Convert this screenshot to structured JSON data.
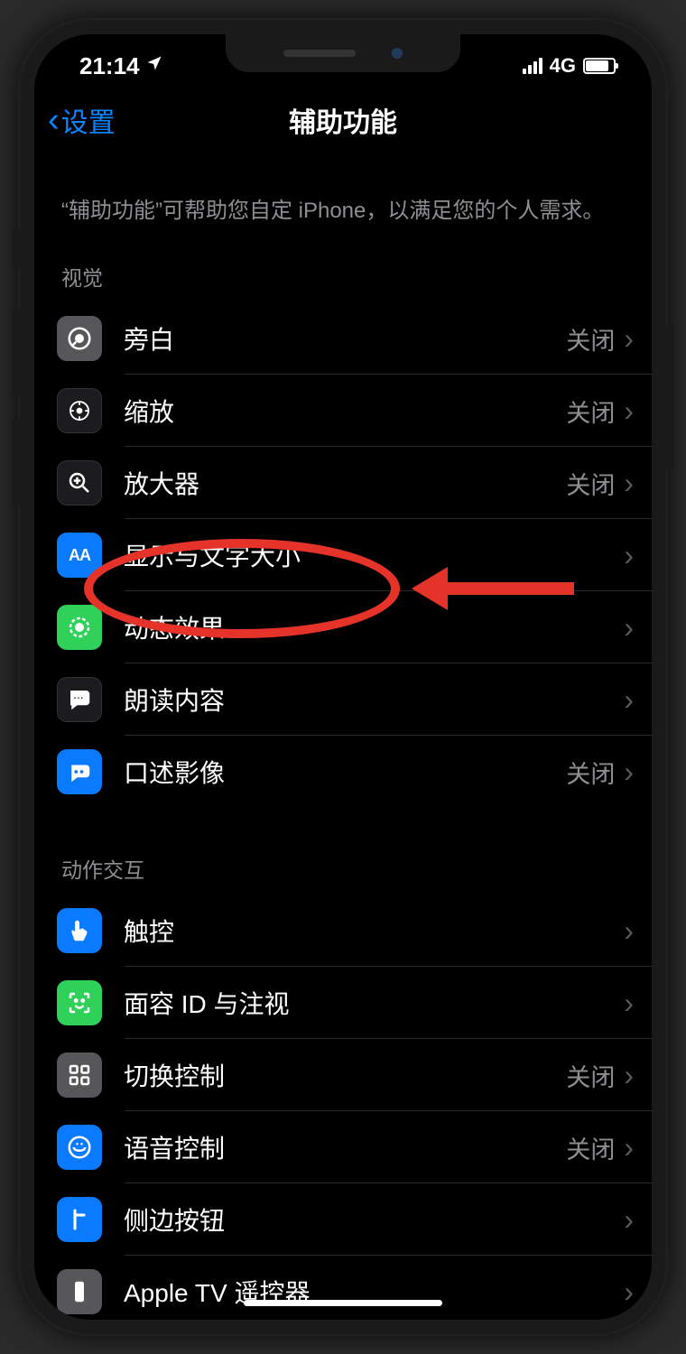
{
  "status": {
    "time": "21:14",
    "network": "4G"
  },
  "nav": {
    "back_label": "设置",
    "title": "辅助功能"
  },
  "description": "“辅助功能”可帮助您自定 iPhone，以满足您的个人需求。",
  "sections": {
    "visual": {
      "header": "视觉",
      "items": [
        {
          "label": "旁白",
          "value": "关闭"
        },
        {
          "label": "缩放",
          "value": "关闭"
        },
        {
          "label": "放大器",
          "value": "关闭"
        },
        {
          "label": "显示与文字大小",
          "value": ""
        },
        {
          "label": "动态效果",
          "value": ""
        },
        {
          "label": "朗读内容",
          "value": ""
        },
        {
          "label": "口述影像",
          "value": "关闭"
        }
      ]
    },
    "motor": {
      "header": "动作交互",
      "items": [
        {
          "label": "触控",
          "value": ""
        },
        {
          "label": "面容 ID 与注视",
          "value": ""
        },
        {
          "label": "切换控制",
          "value": "关闭"
        },
        {
          "label": "语音控制",
          "value": "关闭"
        },
        {
          "label": "侧边按钮",
          "value": ""
        },
        {
          "label": "Apple TV 遥控器",
          "value": ""
        }
      ]
    }
  },
  "annotation": {
    "highlight_row_label": "显示与文字大小"
  }
}
